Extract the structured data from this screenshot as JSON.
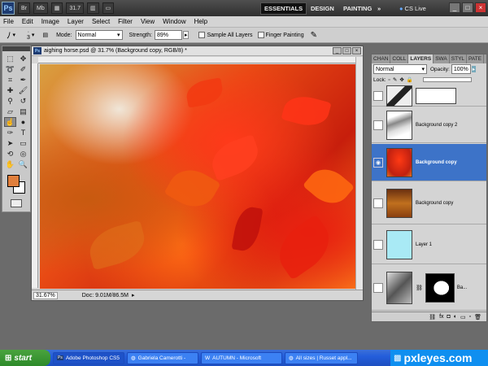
{
  "app": {
    "logo": "Ps",
    "zoom": "31.7",
    "workspaces": [
      "ESSENTIALS",
      "DESIGN",
      "PAINTING"
    ],
    "more": "»",
    "cslive": "CS Live"
  },
  "menu": [
    "File",
    "Edit",
    "Image",
    "Layer",
    "Select",
    "Filter",
    "View",
    "Window",
    "Help"
  ],
  "options": {
    "brush_size": "3",
    "mode_label": "Mode:",
    "mode_value": "Normal",
    "strength_label": "Strength:",
    "strength_value": "89%",
    "sample_all": "Sample All Layers",
    "finger_painting": "Finger Painting"
  },
  "document": {
    "title": "aighing horse.psd @ 31.7% (Background copy, RGB/8) *",
    "zoom_status": "31.67%",
    "doc_status": "Doc: 9.01M/86.5M"
  },
  "layers_panel": {
    "tabs": [
      "CHAN",
      "COLL",
      "LAYERS",
      "SWA",
      "STYL",
      "PATE"
    ],
    "blend_mode": "Normal",
    "opacity_label": "Opacity:",
    "opacity_value": "100%",
    "lock_label": "Lock:",
    "layers": [
      {
        "name": ""
      },
      {
        "name": "Background copy 2"
      },
      {
        "name": "Background copy"
      },
      {
        "name": "Background copy"
      },
      {
        "name": "Layer 1"
      },
      {
        "name": "Ba..."
      }
    ]
  },
  "taskbar": {
    "start": "start",
    "items": [
      "Adobe Photoshop CS5",
      "Gabriela Camerotti -",
      "AUTUMN - Microsoft",
      "All sizes | Russet appl..."
    ],
    "brand": "pxleyes.com"
  },
  "colors": {
    "foreground": "#e07f3c",
    "background": "#ffffff",
    "active_layer": "#3d73c8"
  }
}
